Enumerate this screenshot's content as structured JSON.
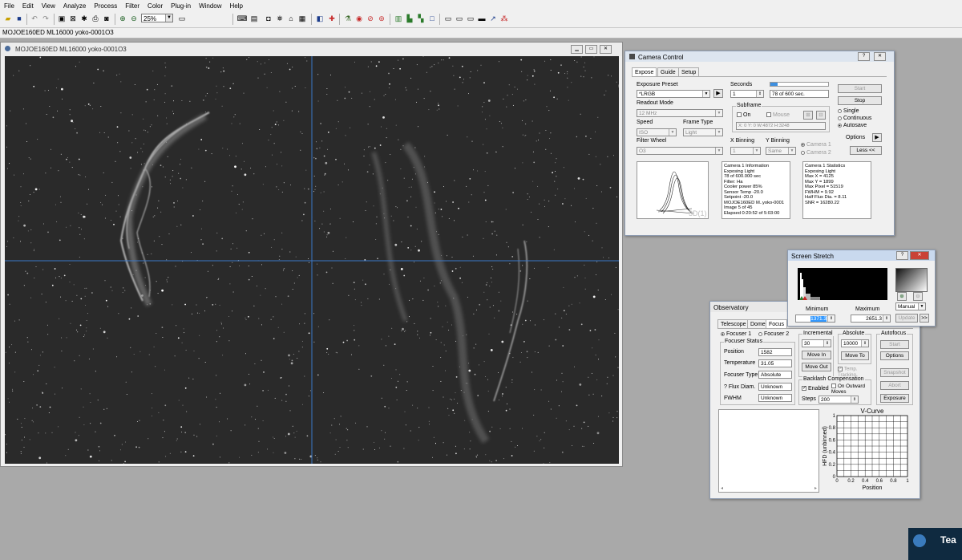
{
  "menu": [
    "File",
    "Edit",
    "View",
    "Analyze",
    "Process",
    "Filter",
    "Color",
    "Plug-in",
    "Window",
    "Help"
  ],
  "toolbar": {
    "zoom": "25%"
  },
  "tabstrip": {
    "label": "MOJOE160ED ML16000 yoko-0001O3"
  },
  "image_window": {
    "title": "MOJOE160ED ML16000 yoko-0001O3"
  },
  "camera_control": {
    "title": "Camera Control",
    "tabs": [
      "Expose",
      "Guide",
      "Setup"
    ],
    "exposure_preset_label": "Exposure Preset",
    "exposure_preset": "*LRGB",
    "seconds_label": "Seconds",
    "seconds": "1",
    "progress_text": "78 of 600 sec.",
    "progress_fraction": 0.13,
    "readout_mode_label": "Readout Mode",
    "readout_mode": "12 MHz",
    "subframe_label": "Subframe",
    "subframe_on": "On",
    "mouse_label": "Mouse",
    "subframe_coords": "X:    0 Y:    0 W:4872 H:3248",
    "speed_label": "Speed",
    "speed": "ISO",
    "frame_type_label": "Frame Type",
    "frame_type": "Light",
    "filter_wheel_label": "Filter Wheel",
    "filter_wheel": "O3",
    "x_binning_label": "X Binning",
    "x_binning": "1",
    "y_binning_label": "Y Binning",
    "y_binning": "Same",
    "camera1": "Camera 1",
    "camera2": "Camera 2",
    "start": "Start",
    "stop": "Stop",
    "single": "Single",
    "continuous": "Continuous",
    "autosave": "Autosave",
    "options": "Options",
    "less": "Less <<",
    "view3d": "3D(1)",
    "info_lines": [
      "Camera 1 Information",
      "Exposing Light",
      "78 of 600.000 sec",
      "Filter: Ha",
      "Cooler power 85%",
      "Sensor Temp -20.0",
      "Setpoint -20.0",
      "MOJOE160ED M..yoko-0001",
      "Image 5 of 45",
      "Elapsed 0:20:52 of 5:03:00"
    ],
    "stats_lines": [
      "Camera 1 Statistics",
      "Exposing Light",
      "Max X = 4125",
      "Max Y = 1899",
      "Max Pixel = 51519",
      "FWHM = 9.92",
      "Half Flux Dia. = 8.11",
      "SNR = 16280.22"
    ]
  },
  "screen_stretch": {
    "title": "Screen Stretch",
    "minimum_label": "Minimum",
    "maximum_label": "Maximum",
    "minimum": "1371.3",
    "maximum": "2651.3",
    "mode": "Manual",
    "update": "Update",
    "more": ">>"
  },
  "observatory": {
    "title": "Observatory",
    "tabs": [
      "Telescope",
      "Dome",
      "Focus"
    ],
    "focuser1": "Focuser 1",
    "focuser2": "Focuser 2",
    "status_label": "Focuser Status",
    "position_label": "Position",
    "position": "1582",
    "temperature_label": "Temperature",
    "temperature": "31.05",
    "focuser_type_label": "Focuser Type",
    "focuser_type": "Absolute",
    "flux_label": "? Flux Diam.",
    "flux": "Unknown",
    "fwhm_label": "FWHM",
    "fwhm": "Unknown",
    "incremental_label": "Incremental",
    "incremental_value": "30",
    "move_in": "Move In",
    "move_out": "Move Out",
    "absolute_label": "Absolute",
    "absolute_value": "10000",
    "move_to": "Move To",
    "temp_tracking": "Temp. Tracking",
    "backlash_label": "Backlash Compensation",
    "enabled": "Enabled",
    "on_outward": "On Outward Moves",
    "steps_label": "Steps",
    "steps": "200",
    "autofocus_label": "Autofocus",
    "start": "Start",
    "options": "Options",
    "snapshot": "Snapshot",
    "abort": "Abort",
    "exposure": "Exposure"
  },
  "chart_data": {
    "type": "line",
    "title": "V-Curve",
    "xlabel": "Position",
    "ylabel": "HFD (unbinned)",
    "xlim": [
      0,
      1
    ],
    "ylim": [
      0,
      1
    ],
    "xticks": [
      "0",
      "0.2",
      "0.4",
      "0.6",
      "0.8",
      "1"
    ],
    "yticks": [
      "0",
      "0.2",
      "0.4",
      "0.6",
      "0.8",
      "1"
    ],
    "grid": true,
    "series": []
  },
  "watermark": {
    "text": "Tea"
  }
}
